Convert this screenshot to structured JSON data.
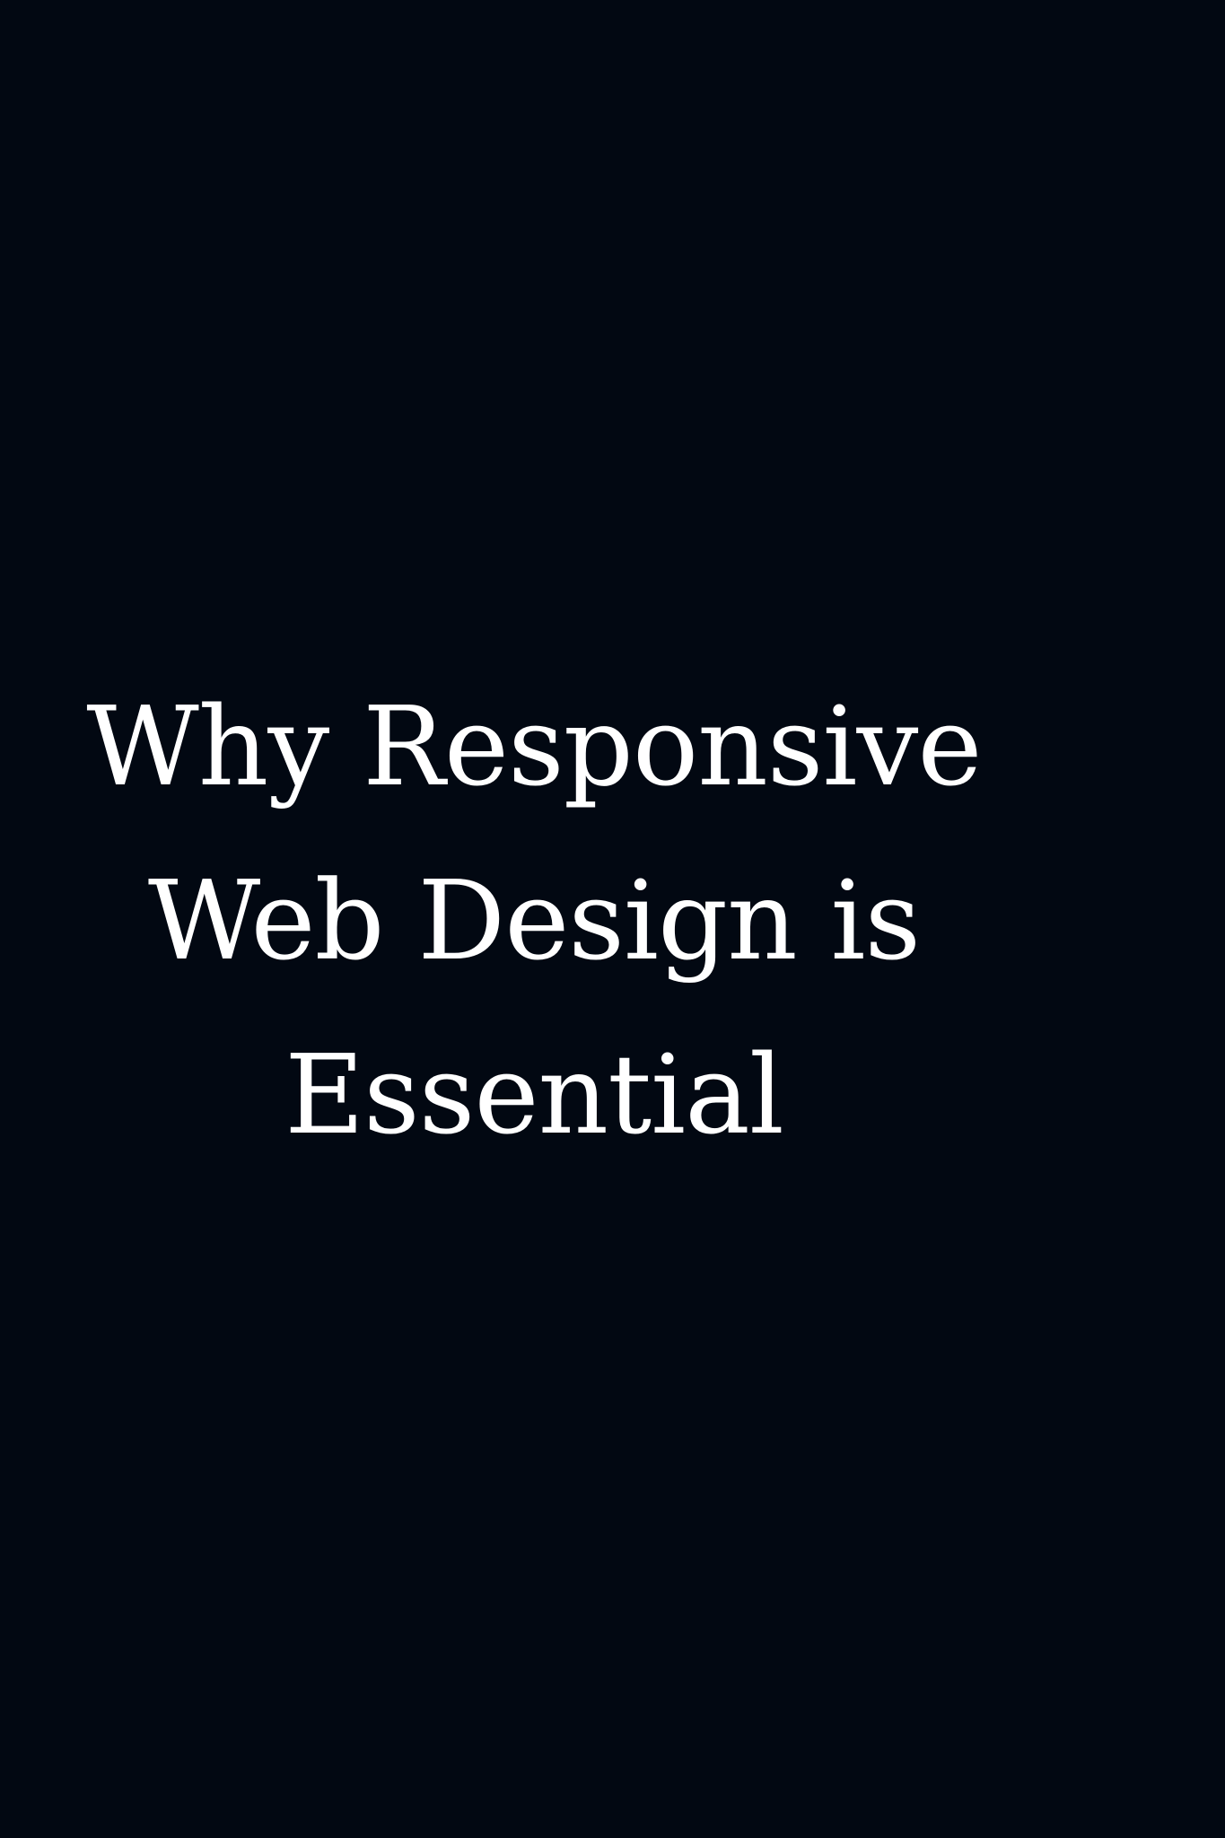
{
  "headline": {
    "lines": [
      "Why Responsive",
      "Web Design is",
      "Essential"
    ]
  },
  "colors": {
    "background": "#020812",
    "text": "#ffffff"
  }
}
